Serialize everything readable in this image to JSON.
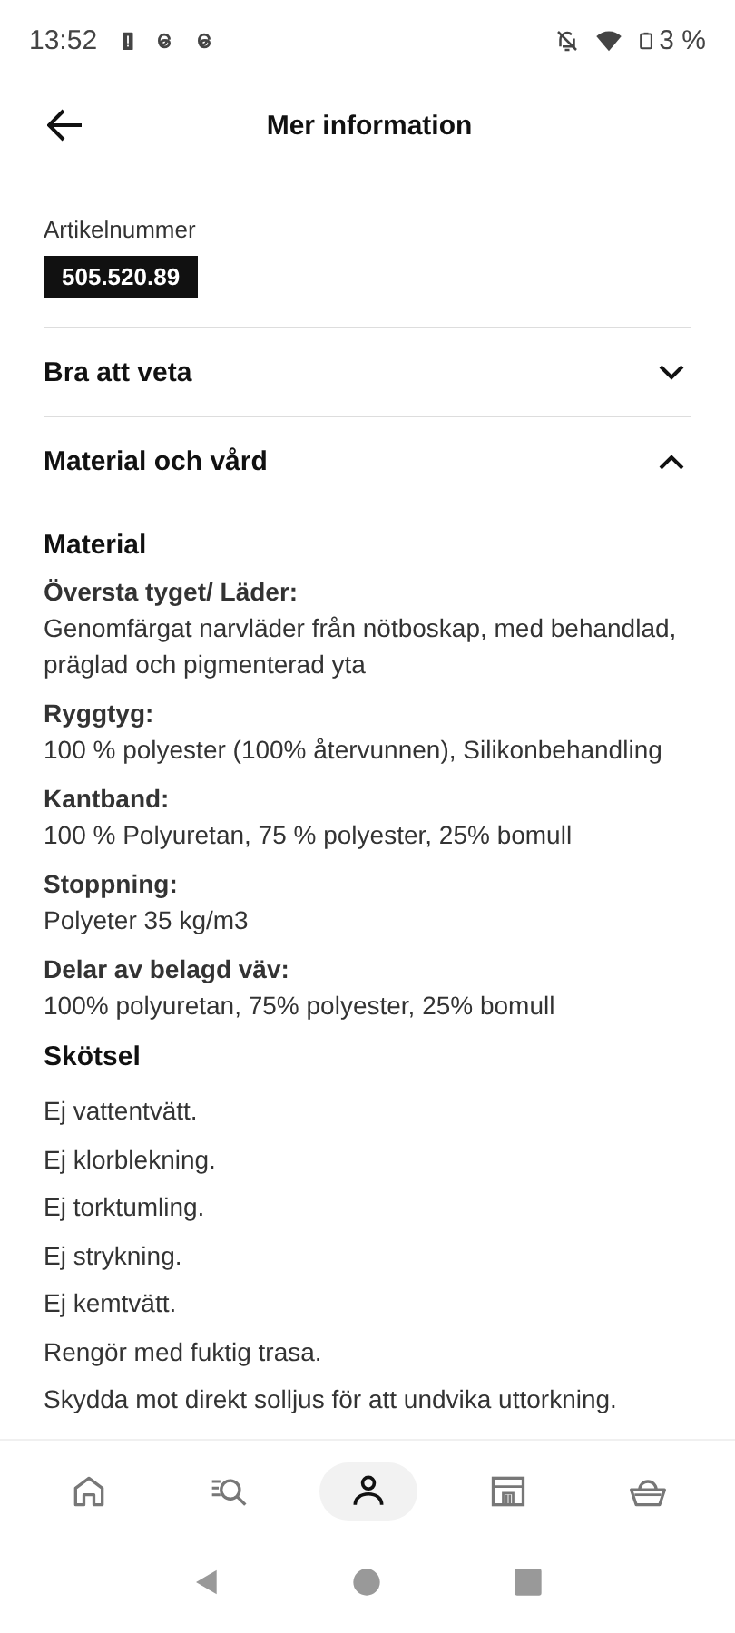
{
  "status_bar": {
    "time": "13:52",
    "battery": "3 %"
  },
  "header": {
    "title": "Mer information"
  },
  "article": {
    "label": "Artikelnummer",
    "number": "505.520.89"
  },
  "sections": [
    {
      "title": "Bra att veta",
      "expanded": false
    },
    {
      "title": "Material och vård",
      "expanded": true,
      "groups": [
        {
          "heading": "Material",
          "entries": [
            {
              "label": "Översta tyget/ Läder:",
              "text": "Genomfärgat narvläder från nötboskap, med behandlad, präglad och pigmenterad yta"
            },
            {
              "label": "Ryggtyg:",
              "text": "100 % polyester (100% återvunnen), Silikonbehandling"
            },
            {
              "label": "Kantband:",
              "text": "100 % Polyuretan, 75 % polyester, 25% bomull"
            },
            {
              "label": "Stoppning:",
              "text": "Polyeter 35 kg/m3"
            },
            {
              "label": "Delar av belagd väv:",
              "text": "100% polyuretan, 75% polyester, 25% bomull"
            }
          ]
        },
        {
          "heading": "Skötsel",
          "lines": [
            "Ej vattentvätt.",
            "Ej klorblekning.",
            "Ej torktumling.",
            "Ej strykning.",
            "Ej kemtvätt.",
            "Rengör med fuktig trasa.",
            "Skydda mot direkt solljus för att undvika uttorkning."
          ]
        }
      ]
    }
  ],
  "nav": [
    {
      "kind": "home",
      "selected": false
    },
    {
      "kind": "search",
      "selected": false
    },
    {
      "kind": "profile",
      "selected": true
    },
    {
      "kind": "store",
      "selected": false
    },
    {
      "kind": "basket",
      "selected": false
    }
  ]
}
